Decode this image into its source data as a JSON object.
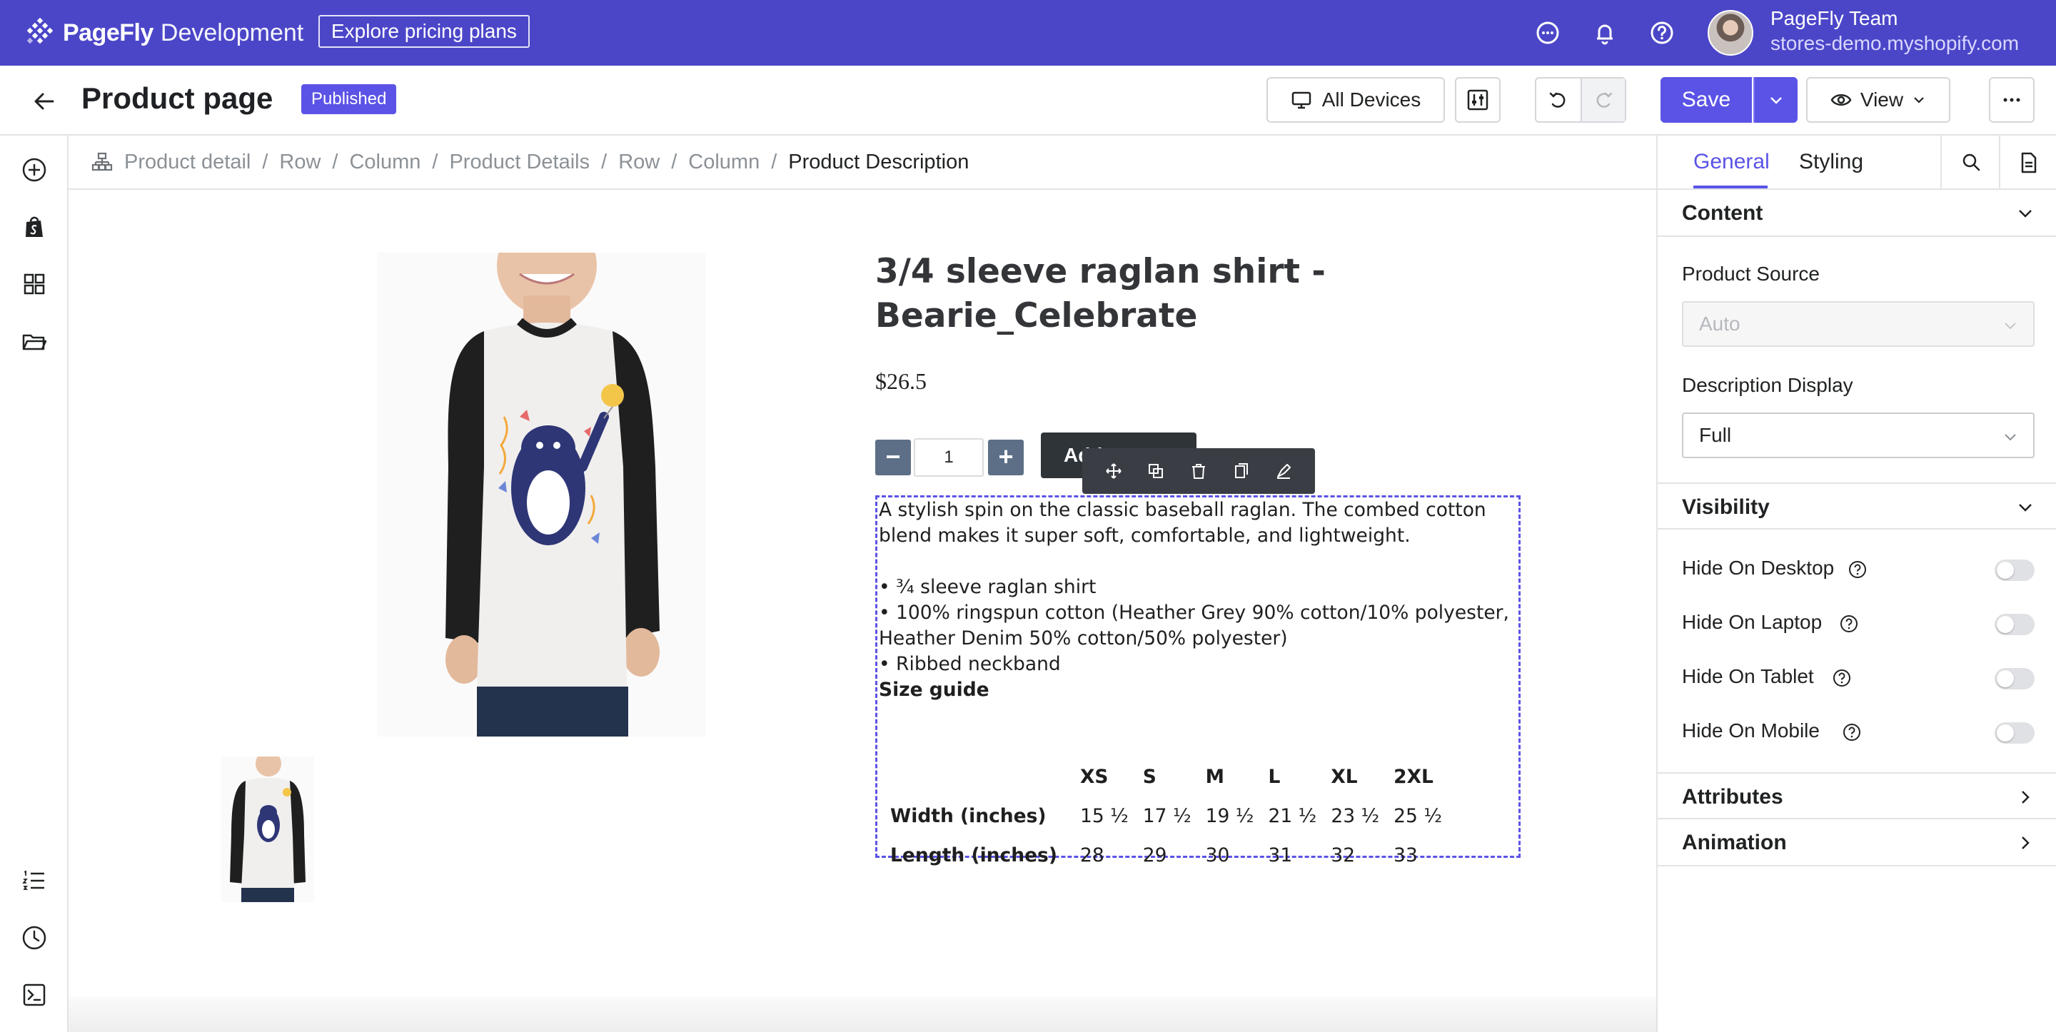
{
  "topbar": {
    "brand": "PageFly",
    "brand_sub": "Development",
    "pricing_label": "Explore pricing plans",
    "user_name": "PageFly Team",
    "user_store": "stores-demo.myshopify.com"
  },
  "header": {
    "title": "Product page",
    "status_badge": "Published",
    "devices_label": "All Devices",
    "save_label": "Save",
    "view_label": "View"
  },
  "breadcrumb": [
    "Product detail",
    "Row",
    "Column",
    "Product Details",
    "Row",
    "Column"
  ],
  "breadcrumb_current": "Product Description",
  "product": {
    "title": "3/4 sleeve raglan shirt - Bearie_Celebrate",
    "price": "$26.5",
    "quantity": "1",
    "add_to_cart": "Add to cart",
    "description_intro": "A stylish spin on the classic baseball raglan. The combed cotton blend makes it super soft, comfortable, and lightweight.",
    "bullets": [
      "• ¾ sleeve raglan shirt",
      "• 100% ringspun cotton (Heather Grey 90% cotton/10% polyester, Heather Denim 50% cotton/50% polyester)",
      "• Ribbed neckband"
    ],
    "size_guide_title": "Size guide",
    "size_table": {
      "headers": [
        "",
        "XS",
        "S",
        "M",
        "L",
        "XL",
        "2XL"
      ],
      "rows": [
        [
          "Width (inches)",
          "15 ½",
          "17 ½",
          "19 ½",
          "21 ½",
          "23 ½",
          "25 ½"
        ],
        [
          "Length (inches)",
          "28",
          "29",
          "30",
          "31",
          "32",
          "33"
        ]
      ]
    }
  },
  "panel": {
    "tabs": [
      "General",
      "Styling"
    ],
    "active_tab": "General",
    "content_section": "Content",
    "product_source_label": "Product Source",
    "product_source_value": "Auto",
    "description_display_label": "Description Display",
    "description_display_value": "Full",
    "visibility_section": "Visibility",
    "toggles": [
      "Hide On Desktop",
      "Hide On Laptop",
      "Hide On Tablet",
      "Hide On Mobile"
    ],
    "attributes_section": "Attributes",
    "animation_section": "Animation"
  },
  "colors": {
    "brand": "#4b46c8",
    "accent": "#5b53e6",
    "border": "#e1e3e5"
  },
  "icons": {
    "topbar": [
      "chat-icon",
      "bell-icon",
      "help-icon"
    ],
    "left_rail": [
      "add-icon",
      "shopify-icon",
      "grid-icon",
      "folder-icon",
      "list-icon",
      "clock-icon",
      "terminal-icon"
    ],
    "element_toolbar": [
      "move-icon",
      "duplicate-icon",
      "delete-icon",
      "copy-icon",
      "style-icon"
    ]
  }
}
